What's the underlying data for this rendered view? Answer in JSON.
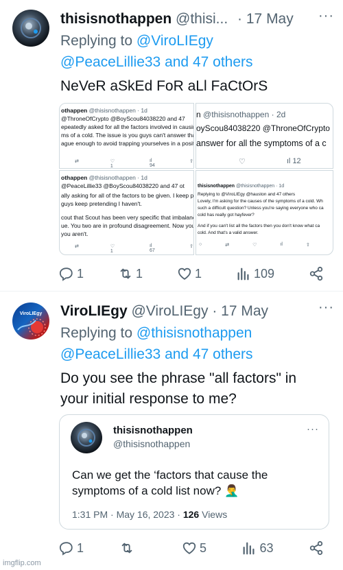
{
  "tweet1": {
    "name": "thisisnothappen",
    "handle": "@thisi...",
    "dot": "·",
    "date": "17 May",
    "replying_prefix": "Replying to",
    "replying_to": "@ViroLIEgy",
    "replying_others": "@PeaceLillie33 and 47 others",
    "text": "NeVeR aSkEd FoR aLl FaCtOrS",
    "images": {
      "a": {
        "line1_name": "othappen",
        "line1_handle": "@thisisnothappen · 1d",
        "line2": "@ThroneOfCrypto @BoyScou84038220 and 47",
        "line3": "epeatedly asked for all the factors involved in causin",
        "line4": "ms of a cold. The issue is you guys can't answer that",
        "line5": "ague enough to avoid trapping yourselves in a positiv",
        "stat": "94"
      },
      "b": {
        "line1_name": "n",
        "line1_handle": "@thisisnothappen · 2d",
        "line2": "oyScou84038220 @ThroneOfCrypto",
        "line3": "answer for all the symptoms of a c",
        "stat": "12"
      },
      "c": {
        "line1_name": "othappen",
        "line1_handle": "@thisisnothappen · 1d",
        "line2": "@PeaceLillie33 @BoyScou84038220 and 47 ot",
        "line3": "ally asking for all of the factors to be given. I keep po",
        "line4": "guys keep pretending I haven't.",
        "line5": "cout that Scout has been very specific that imbalanc",
        "line6": "ue. You two are in profound disagreement. Now you'",
        "line7": "you aren't.",
        "stat": "67"
      },
      "d": {
        "line1_name": "thisisnothappen",
        "line1_handle": "@thisisnothappen · 1d",
        "line2": "Replying to @ViroLIEgy @hauston and 47 others",
        "line3": "Lovely, I'm asking for the causes of the symptoms of a cold. Wh",
        "line4": "such a difficult question? Unless you're saying everyone who ca",
        "line5": "cold has really got hayfever?",
        "line6": "And if you can't list all the factors then you don't know what ca",
        "line7": "cold. And that's a valid answer."
      }
    },
    "actions": {
      "replies": "1",
      "retweets": "1",
      "likes": "1",
      "views": "109"
    }
  },
  "tweet2": {
    "name": "ViroLIEgy",
    "handle": "@ViroLIEgy",
    "dot": "·",
    "date": "17 May",
    "avatar_text": "ViroLIEgy",
    "replying_prefix": "Replying to",
    "replying_to": "@thisisnothappen",
    "replying_others": "@PeaceLillie33 and 47 others",
    "text": "Do you see the phrase \"all factors\" in your initial response to me?",
    "quote": {
      "name": "thisisnothappen",
      "handle": "@thisisnothappen",
      "text": "Can we get the ‘factors that cause the symptoms of a cold list now? 🤦‍♂️",
      "time": "1:31 PM · May 16, 2023 ·",
      "views_count": "126",
      "views_label": "Views"
    },
    "actions": {
      "replies": "1",
      "retweets": "",
      "likes": "5",
      "views": "63"
    }
  },
  "watermark": "imgflip.com",
  "colors": {
    "link": "#1d9bf0",
    "secondary": "#536471",
    "border": "#cfd9de"
  }
}
